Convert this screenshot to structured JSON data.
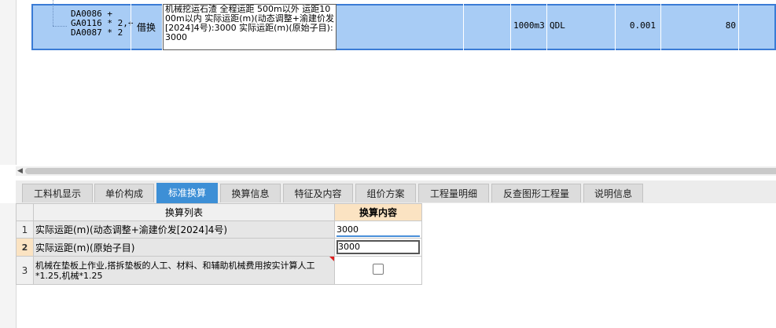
{
  "top_row": {
    "tree_code": "DA0086 +\nGA0116 * 2,+\nDA0087 * 2",
    "type": "借换",
    "description": "机械挖运石渣 全程运距 500m以外 运距1000m以内  实际运距(m)(动态调整+渝建价发[2024]4号):3000  实际运距(m)(原始子目):3000",
    "unit": "1000m3",
    "code": "QDL",
    "qty": "0.001",
    "value": "80"
  },
  "tabs": [
    {
      "label": "工料机显示"
    },
    {
      "label": "单价构成"
    },
    {
      "label": "标准换算"
    },
    {
      "label": "换算信息"
    },
    {
      "label": "特征及内容"
    },
    {
      "label": "组价方案"
    },
    {
      "label": "工程量明细"
    },
    {
      "label": "反查图形工程量"
    },
    {
      "label": "说明信息"
    }
  ],
  "active_tab": "标准换算",
  "conversion": {
    "col_list": "换算列表",
    "col_content": "换算内容",
    "rows": [
      {
        "num": "1",
        "name": "实际运距(m)(动态调整+渝建价发[2024]4号)",
        "value": "3000"
      },
      {
        "num": "2",
        "name": "实际运距(m)(原始子目)",
        "value": "3000"
      },
      {
        "num": "3",
        "name": "机械在垫板上作业,搭拆垫板的人工、材料、和辅助机械费用按实计算人工*1.25,机械*1.25",
        "value": "",
        "checked": false
      }
    ]
  },
  "colors": {
    "selected_row": "#a8ccf5",
    "active_tab": "#3d8fd6",
    "header_content": "#fbe3c2"
  }
}
